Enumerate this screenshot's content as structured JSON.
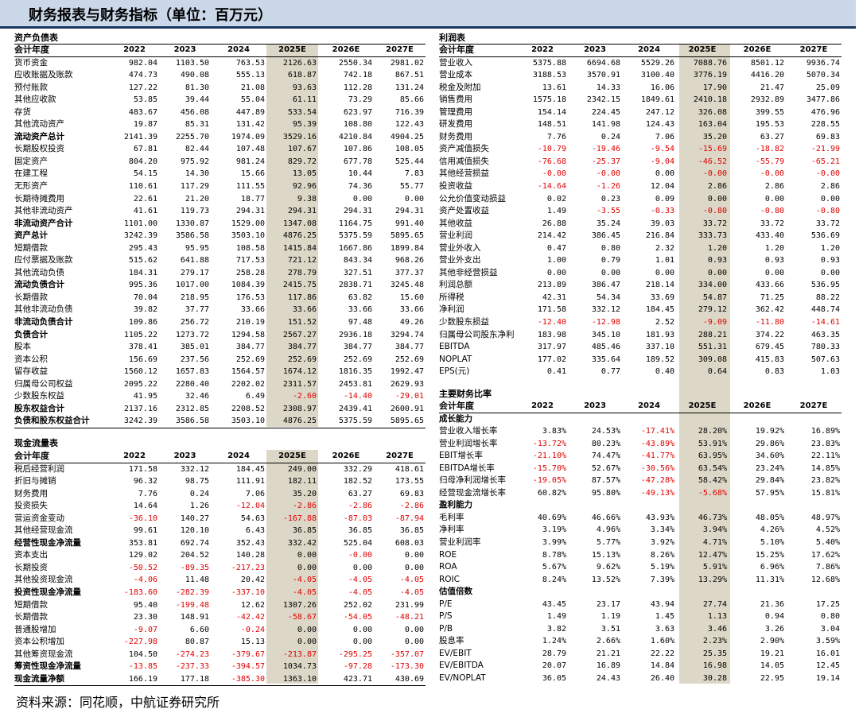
{
  "banner": {
    "title": "财务报表与财务指标（单位：百万元）"
  },
  "years": [
    "2022",
    "2023",
    "2024",
    "2025E",
    "2026E",
    "2027E"
  ],
  "sections": {
    "balance": {
      "title": "资产负债表",
      "header": "会计年度"
    },
    "income": {
      "title": "利润表",
      "header": "会计年度"
    },
    "cashflow": {
      "title": "现金流量表",
      "header": "会计年度"
    },
    "ratios": {
      "title": "主要财务比率",
      "header": "会计年度"
    }
  },
  "balance_rows": [
    {
      "label": "货币资金",
      "values": [
        "982.04",
        "1103.50",
        "763.53",
        "2126.63",
        "2550.34",
        "2981.02"
      ]
    },
    {
      "label": "应收账据及账款",
      "values": [
        "474.73",
        "490.08",
        "555.13",
        "618.87",
        "742.18",
        "867.51"
      ]
    },
    {
      "label": "预付账款",
      "values": [
        "127.22",
        "81.30",
        "21.08",
        "93.63",
        "112.28",
        "131.24"
      ]
    },
    {
      "label": "其他应收款",
      "values": [
        "53.85",
        "39.44",
        "55.04",
        "61.11",
        "73.29",
        "85.66"
      ]
    },
    {
      "label": "存货",
      "values": [
        "483.67",
        "456.08",
        "447.89",
        "533.54",
        "623.97",
        "716.39"
      ]
    },
    {
      "label": "其他流动资产",
      "values": [
        "19.87",
        "85.31",
        "131.42",
        "95.39",
        "108.80",
        "122.43"
      ]
    },
    {
      "label": "流动资产总计",
      "bold": true,
      "values": [
        "2141.39",
        "2255.70",
        "1974.09",
        "3529.16",
        "4210.84",
        "4904.25"
      ]
    },
    {
      "label": "长期股权投资",
      "values": [
        "67.81",
        "82.44",
        "107.48",
        "107.67",
        "107.86",
        "108.05"
      ]
    },
    {
      "label": "固定资产",
      "values": [
        "804.20",
        "975.92",
        "981.24",
        "829.72",
        "677.78",
        "525.44"
      ]
    },
    {
      "label": "在建工程",
      "values": [
        "54.15",
        "14.30",
        "15.66",
        "13.05",
        "10.44",
        "7.83"
      ]
    },
    {
      "label": "无形资产",
      "values": [
        "110.61",
        "117.29",
        "111.55",
        "92.96",
        "74.36",
        "55.77"
      ]
    },
    {
      "label": "长期待摊费用",
      "values": [
        "22.61",
        "21.20",
        "18.77",
        "9.38",
        "0.00",
        "0.00"
      ]
    },
    {
      "label": "其他非流动资产",
      "values": [
        "41.61",
        "119.73",
        "294.31",
        "294.31",
        "294.31",
        "294.31"
      ]
    },
    {
      "label": "非流动资产合计",
      "bold": true,
      "values": [
        "1101.00",
        "1330.87",
        "1529.00",
        "1347.08",
        "1164.75",
        "991.40"
      ]
    },
    {
      "label": "资产总计",
      "bold": true,
      "values": [
        "3242.39",
        "3586.58",
        "3503.10",
        "4876.25",
        "5375.59",
        "5895.65"
      ]
    },
    {
      "label": "短期借款",
      "values": [
        "295.43",
        "95.95",
        "108.58",
        "1415.84",
        "1667.86",
        "1899.84"
      ]
    },
    {
      "label": "应付票据及账款",
      "values": [
        "515.62",
        "641.88",
        "717.53",
        "721.12",
        "843.34",
        "968.26"
      ]
    },
    {
      "label": "其他流动负债",
      "values": [
        "184.31",
        "279.17",
        "258.28",
        "278.79",
        "327.51",
        "377.37"
      ]
    },
    {
      "label": "流动负债合计",
      "bold": true,
      "values": [
        "995.36",
        "1017.00",
        "1084.39",
        "2415.75",
        "2838.71",
        "3245.48"
      ]
    },
    {
      "label": "长期借款",
      "values": [
        "70.04",
        "218.95",
        "176.53",
        "117.86",
        "63.82",
        "15.60"
      ]
    },
    {
      "label": "其他非流动负债",
      "values": [
        "39.82",
        "37.77",
        "33.66",
        "33.66",
        "33.66",
        "33.66"
      ]
    },
    {
      "label": "非流动负债合计",
      "bold": true,
      "values": [
        "109.86",
        "256.72",
        "210.19",
        "151.52",
        "97.48",
        "49.26"
      ]
    },
    {
      "label": "负债合计",
      "bold": true,
      "values": [
        "1105.22",
        "1273.72",
        "1294.58",
        "2567.27",
        "2936.18",
        "3294.74"
      ]
    },
    {
      "label": "股本",
      "values": [
        "378.41",
        "385.01",
        "384.77",
        "384.77",
        "384.77",
        "384.77"
      ]
    },
    {
      "label": "资本公积",
      "values": [
        "156.69",
        "237.56",
        "252.69",
        "252.69",
        "252.69",
        "252.69"
      ]
    },
    {
      "label": "留存收益",
      "values": [
        "1560.12",
        "1657.83",
        "1564.57",
        "1674.12",
        "1816.35",
        "1992.47"
      ]
    },
    {
      "label": "归属母公司权益",
      "values": [
        "2095.22",
        "2280.40",
        "2202.02",
        "2311.57",
        "2453.81",
        "2629.93"
      ]
    },
    {
      "label": "少数股东权益",
      "values": [
        "41.95",
        "32.46",
        "6.49",
        "-2.60",
        "-14.40",
        "-29.01"
      ]
    },
    {
      "label": "股东权益合计",
      "bold": true,
      "values": [
        "2137.16",
        "2312.85",
        "2208.52",
        "2308.97",
        "2439.41",
        "2600.91"
      ]
    },
    {
      "label": "负债和股东权益合计",
      "bold": true,
      "values": [
        "3242.39",
        "3586.58",
        "3503.10",
        "4876.25",
        "5375.59",
        "5895.65"
      ]
    }
  ],
  "cashflow_rows": [
    {
      "label": "税后经营利润",
      "values": [
        "171.58",
        "332.12",
        "184.45",
        "249.00",
        "332.29",
        "418.61"
      ]
    },
    {
      "label": "折旧与摊销",
      "values": [
        "96.32",
        "98.75",
        "111.91",
        "182.11",
        "182.52",
        "173.55"
      ]
    },
    {
      "label": "财务费用",
      "values": [
        "7.76",
        "0.24",
        "7.06",
        "35.20",
        "63.27",
        "69.83"
      ]
    },
    {
      "label": "投资损失",
      "values": [
        "14.64",
        "1.26",
        "-12.04",
        "-2.86",
        "-2.86",
        "-2.86"
      ]
    },
    {
      "label": "营运资金变动",
      "values": [
        "-36.10",
        "140.27",
        "54.63",
        "-167.88",
        "-87.03",
        "-87.94"
      ]
    },
    {
      "label": "其他经营现金流",
      "values": [
        "99.61",
        "120.10",
        "6.43",
        "36.85",
        "36.85",
        "36.85"
      ]
    },
    {
      "label": "经营性现金净流量",
      "bold": true,
      "values": [
        "353.81",
        "692.74",
        "352.43",
        "332.42",
        "525.04",
        "608.03"
      ]
    },
    {
      "label": "资本支出",
      "values": [
        "129.02",
        "204.52",
        "140.28",
        "0.00",
        "-0.00",
        "0.00"
      ]
    },
    {
      "label": "长期投资",
      "values": [
        "-50.52",
        "-89.35",
        "-217.23",
        "0.00",
        "0.00",
        "0.00"
      ]
    },
    {
      "label": "其他投资现金流",
      "values": [
        "-4.06",
        "11.48",
        "20.42",
        "-4.05",
        "-4.05",
        "-4.05"
      ]
    },
    {
      "label": "投资性现金净流量",
      "bold": true,
      "values": [
        "-183.60",
        "-282.39",
        "-337.10",
        "-4.05",
        "-4.05",
        "-4.05"
      ]
    },
    {
      "label": "短期借款",
      "values": [
        "95.40",
        "-199.48",
        "12.62",
        "1307.26",
        "252.02",
        "231.99"
      ]
    },
    {
      "label": "长期借款",
      "values": [
        "23.30",
        "148.91",
        "-42.42",
        "-58.67",
        "-54.05",
        "-48.21"
      ]
    },
    {
      "label": "普通股增加",
      "values": [
        "-9.07",
        "6.60",
        "-0.24",
        "0.00",
        "0.00",
        "0.00"
      ]
    },
    {
      "label": "资本公积增加",
      "values": [
        "-227.98",
        "80.87",
        "15.13",
        "0.00",
        "0.00",
        "0.00"
      ]
    },
    {
      "label": "其他筹资现金流",
      "values": [
        "104.50",
        "-274.23",
        "-379.67",
        "-213.87",
        "-295.25",
        "-357.07"
      ]
    },
    {
      "label": "筹资性现金净流量",
      "bold": true,
      "values": [
        "-13.85",
        "-237.33",
        "-394.57",
        "1034.73",
        "-97.28",
        "-173.30"
      ]
    },
    {
      "label": "现金流量净额",
      "bold": true,
      "values": [
        "166.19",
        "177.18",
        "-385.30",
        "1363.10",
        "423.71",
        "430.69"
      ]
    }
  ],
  "income_rows": [
    {
      "label": "营业收入",
      "values": [
        "5375.88",
        "6694.68",
        "5529.26",
        "7088.76",
        "8501.12",
        "9936.74"
      ]
    },
    {
      "label": "营业成本",
      "values": [
        "3188.53",
        "3570.91",
        "3100.40",
        "3776.19",
        "4416.20",
        "5070.34"
      ]
    },
    {
      "label": "税金及附加",
      "values": [
        "13.61",
        "14.33",
        "16.06",
        "17.90",
        "21.47",
        "25.09"
      ]
    },
    {
      "label": "销售费用",
      "values": [
        "1575.18",
        "2342.15",
        "1849.61",
        "2410.18",
        "2932.89",
        "3477.86"
      ]
    },
    {
      "label": "管理费用",
      "values": [
        "154.14",
        "224.45",
        "247.12",
        "326.08",
        "399.55",
        "476.96"
      ]
    },
    {
      "label": "研发费用",
      "values": [
        "148.51",
        "141.98",
        "124.43",
        "163.04",
        "195.53",
        "228.55"
      ]
    },
    {
      "label": "财务费用",
      "values": [
        "7.76",
        "0.24",
        "7.06",
        "35.20",
        "63.27",
        "69.83"
      ]
    },
    {
      "label": "资产减值损失",
      "values": [
        "-10.79",
        "-19.46",
        "-9.54",
        "-15.69",
        "-18.82",
        "-21.99"
      ]
    },
    {
      "label": "信用减值损失",
      "values": [
        "-76.68",
        "-25.37",
        "-9.04",
        "-46.52",
        "-55.79",
        "-65.21"
      ]
    },
    {
      "label": "其他经营损益",
      "values": [
        "-0.00",
        "-0.00",
        "0.00",
        "-0.00",
        "-0.00",
        "-0.00"
      ]
    },
    {
      "label": "投资收益",
      "values": [
        "-14.64",
        "-1.26",
        "12.04",
        "2.86",
        "2.86",
        "2.86"
      ]
    },
    {
      "label": "公允价值变动损益",
      "values": [
        "0.02",
        "0.23",
        "0.09",
        "0.00",
        "0.00",
        "0.00"
      ]
    },
    {
      "label": "资产处置收益",
      "values": [
        "1.49",
        "-3.55",
        "-0.33",
        "-0.80",
        "-0.80",
        "-0.80"
      ]
    },
    {
      "label": "其他收益",
      "values": [
        "26.88",
        "35.24",
        "39.03",
        "33.72",
        "33.72",
        "33.72"
      ]
    },
    {
      "label": "营业利润",
      "values": [
        "214.42",
        "386.45",
        "216.84",
        "333.73",
        "433.40",
        "536.69"
      ]
    },
    {
      "label": "营业外收入",
      "values": [
        "0.47",
        "0.80",
        "2.32",
        "1.20",
        "1.20",
        "1.20"
      ]
    },
    {
      "label": "营业外支出",
      "values": [
        "1.00",
        "0.79",
        "1.01",
        "0.93",
        "0.93",
        "0.93"
      ]
    },
    {
      "label": "其他非经营损益",
      "values": [
        "0.00",
        "0.00",
        "0.00",
        "0.00",
        "0.00",
        "0.00"
      ]
    },
    {
      "label": "利润总额",
      "values": [
        "213.89",
        "386.47",
        "218.14",
        "334.00",
        "433.66",
        "536.95"
      ]
    },
    {
      "label": "所得税",
      "values": [
        "42.31",
        "54.34",
        "33.69",
        "54.87",
        "71.25",
        "88.22"
      ]
    },
    {
      "label": "净利润",
      "values": [
        "171.58",
        "332.12",
        "184.45",
        "279.12",
        "362.42",
        "448.74"
      ]
    },
    {
      "label": "少数股东损益",
      "values": [
        "-12.40",
        "-12.98",
        "2.52",
        "-9.09",
        "-11.80",
        "-14.61"
      ]
    },
    {
      "label": "归属母公司股东净利",
      "values": [
        "183.98",
        "345.10",
        "181.93",
        "288.21",
        "374.22",
        "463.35"
      ]
    },
    {
      "label": "EBITDA",
      "values": [
        "317.97",
        "485.46",
        "337.10",
        "551.31",
        "679.45",
        "780.33"
      ]
    },
    {
      "label": "NOPLAT",
      "values": [
        "177.02",
        "335.64",
        "189.52",
        "309.08",
        "415.83",
        "507.63"
      ]
    },
    {
      "label": "EPS(元)",
      "values": [
        "0.41",
        "0.77",
        "0.40",
        "0.64",
        "0.83",
        "1.03"
      ]
    }
  ],
  "ratio_groups": [
    {
      "group": "成长能力",
      "rows": [
        {
          "label": "营业收入增长率",
          "values": [
            "3.83%",
            "24.53%",
            "-17.41%",
            "28.20%",
            "19.92%",
            "16.89%"
          ]
        },
        {
          "label": "营业利润增长率",
          "values": [
            "-13.72%",
            "80.23%",
            "-43.89%",
            "53.91%",
            "29.86%",
            "23.83%"
          ]
        },
        {
          "label": "EBIT增长率",
          "values": [
            "-21.10%",
            "74.47%",
            "-41.77%",
            "63.95%",
            "34.60%",
            "22.11%"
          ]
        },
        {
          "label": "EBITDA增长率",
          "values": [
            "-15.70%",
            "52.67%",
            "-30.56%",
            "63.54%",
            "23.24%",
            "14.85%"
          ]
        },
        {
          "label": "归母净利润增长率",
          "values": [
            "-19.05%",
            "87.57%",
            "-47.28%",
            "58.42%",
            "29.84%",
            "23.82%"
          ]
        },
        {
          "label": "经营现金流增长率",
          "values": [
            "60.82%",
            "95.80%",
            "-49.13%",
            "-5.68%",
            "57.95%",
            "15.81%"
          ]
        }
      ]
    },
    {
      "group": "盈利能力",
      "rows": [
        {
          "label": "毛利率",
          "values": [
            "40.69%",
            "46.66%",
            "43.93%",
            "46.73%",
            "48.05%",
            "48.97%"
          ]
        },
        {
          "label": "净利率",
          "values": [
            "3.19%",
            "4.96%",
            "3.34%",
            "3.94%",
            "4.26%",
            "4.52%"
          ]
        },
        {
          "label": "营业利润率",
          "values": [
            "3.99%",
            "5.77%",
            "3.92%",
            "4.71%",
            "5.10%",
            "5.40%"
          ]
        },
        {
          "label": "ROE",
          "values": [
            "8.78%",
            "15.13%",
            "8.26%",
            "12.47%",
            "15.25%",
            "17.62%"
          ]
        },
        {
          "label": "ROA",
          "values": [
            "5.67%",
            "9.62%",
            "5.19%",
            "5.91%",
            "6.96%",
            "7.86%"
          ]
        },
        {
          "label": "ROIC",
          "values": [
            "8.24%",
            "13.52%",
            "7.39%",
            "13.29%",
            "11.31%",
            "12.68%"
          ]
        }
      ]
    },
    {
      "group": "估值倍数",
      "rows": [
        {
          "label": "P/E",
          "values": [
            "43.45",
            "23.17",
            "43.94",
            "27.74",
            "21.36",
            "17.25"
          ]
        },
        {
          "label": "P/S",
          "values": [
            "1.49",
            "1.19",
            "1.45",
            "1.13",
            "0.94",
            "0.80"
          ]
        },
        {
          "label": "P/B",
          "values": [
            "3.82",
            "3.51",
            "3.63",
            "3.46",
            "3.26",
            "3.04"
          ]
        },
        {
          "label": "股息率",
          "values": [
            "1.24%",
            "2.66%",
            "1.60%",
            "2.23%",
            "2.90%",
            "3.59%"
          ]
        },
        {
          "label": "EV/EBIT",
          "values": [
            "28.79",
            "21.21",
            "22.22",
            "25.35",
            "19.21",
            "16.01"
          ]
        },
        {
          "label": "EV/EBITDA",
          "values": [
            "20.07",
            "16.89",
            "14.84",
            "16.98",
            "14.05",
            "12.45"
          ]
        },
        {
          "label": "EV/NOPLAT",
          "values": [
            "36.05",
            "24.43",
            "26.40",
            "30.28",
            "22.95",
            "19.14"
          ]
        }
      ]
    }
  ],
  "source": "资料来源：同花顺，中航证券研究所"
}
